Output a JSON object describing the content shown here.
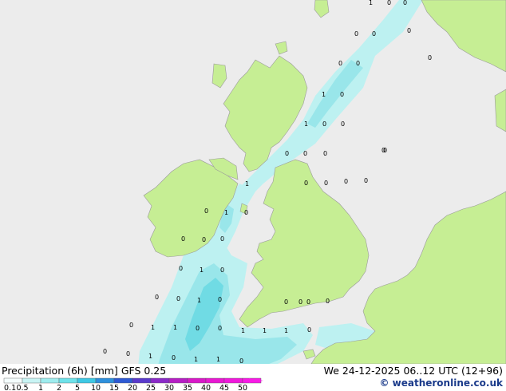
{
  "title": "Precipitation (6h) [mm]",
  "model": "GFS 0.25",
  "datetime": "We 24-12-2025 06..12 UTC (12+96)",
  "credit": "© weatheronline.co.uk",
  "legend": {
    "ticks": [
      "0.1",
      "0.5",
      "1",
      "2",
      "5",
      "10",
      "15",
      "20",
      "25",
      "30",
      "35",
      "40",
      "45",
      "50"
    ],
    "colors": [
      "#f5fdfd",
      "#c8f4f4",
      "#9eecee",
      "#6ee2ea",
      "#3ec8e4",
      "#2f90dc",
      "#2e5ad4",
      "#5a3acc",
      "#8a2ac8",
      "#b61ec4",
      "#d818c8",
      "#e818d2",
      "#f018dc",
      "#f81ae6"
    ]
  },
  "colors": {
    "sea": "#ececec",
    "land": "#c6ee94",
    "border": "#9a9a9a",
    "precip_light": "#bdf1f1",
    "precip_medium": "#99e6ea",
    "precip_strong": "#70dbe4"
  },
  "map_labels": [
    {
      "name": "label-north-1",
      "text": "1"
    },
    {
      "name": "label-north-2",
      "text": "0"
    },
    {
      "name": "label-north-3",
      "text": "0"
    },
    {
      "name": "label-north-4",
      "text": "0"
    },
    {
      "name": "label-north-5",
      "text": "0"
    },
    {
      "name": "label-north-6",
      "text": "0"
    },
    {
      "name": "label-north-7",
      "text": "0"
    },
    {
      "name": "label-north-8",
      "text": "0"
    },
    {
      "name": "label-north-9",
      "text": "0"
    },
    {
      "name": "label-scot-1",
      "text": "1"
    },
    {
      "name": "label-scot-2",
      "text": "0"
    },
    {
      "name": "label-scot-3",
      "text": "1"
    },
    {
      "name": "label-scot-4",
      "text": "0"
    },
    {
      "name": "label-scot-5",
      "text": "0"
    },
    {
      "name": "label-ns-1",
      "text": "0"
    },
    {
      "name": "label-ns-2",
      "text": "0"
    },
    {
      "name": "label-ns-3",
      "text": "0"
    },
    {
      "name": "label-ns-4",
      "text": "0"
    },
    {
      "name": "label-ns-5",
      "text": "0"
    },
    {
      "name": "label-ns-6",
      "text": "0"
    },
    {
      "name": "label-ns-7",
      "text": "0"
    },
    {
      "name": "label-ns-8",
      "text": "0"
    },
    {
      "name": "label-ns-9",
      "text": "0"
    },
    {
      "name": "label-irish-1",
      "text": "1"
    },
    {
      "name": "label-irish-2",
      "text": "0"
    },
    {
      "name": "label-irish-3",
      "text": "1"
    },
    {
      "name": "label-irish-4",
      "text": "0"
    },
    {
      "name": "label-irish-5",
      "text": "0"
    },
    {
      "name": "label-irish-6",
      "text": "0"
    },
    {
      "name": "label-irish-7",
      "text": "0"
    },
    {
      "name": "label-celtic-1",
      "text": "1"
    },
    {
      "name": "label-celtic-2",
      "text": "0"
    },
    {
      "name": "label-celtic-3",
      "text": "0"
    },
    {
      "name": "label-celtic-4",
      "text": "0"
    },
    {
      "name": "label-celtic-5",
      "text": "1"
    },
    {
      "name": "label-celtic-6",
      "text": "0"
    },
    {
      "name": "label-celtic-7",
      "text": "0"
    },
    {
      "name": "label-chan-1",
      "text": "0"
    },
    {
      "name": "label-chan-2",
      "text": "0"
    },
    {
      "name": "label-chan-3",
      "text": "0"
    },
    {
      "name": "label-chan-4",
      "text": "0"
    },
    {
      "name": "label-sw-1",
      "text": "0"
    },
    {
      "name": "label-sw-2",
      "text": "1"
    },
    {
      "name": "label-sw-3",
      "text": "1"
    },
    {
      "name": "label-sw-4",
      "text": "0"
    },
    {
      "name": "label-sw-5",
      "text": "0"
    },
    {
      "name": "label-sw-6",
      "text": "1"
    },
    {
      "name": "label-sw-7",
      "text": "1"
    },
    {
      "name": "label-sw-8",
      "text": "1"
    },
    {
      "name": "label-sw-9",
      "text": "0"
    },
    {
      "name": "label-sw-10",
      "text": "0"
    },
    {
      "name": "label-sw-11",
      "text": "0"
    },
    {
      "name": "label-sw-12",
      "text": "1"
    },
    {
      "name": "label-sw-13",
      "text": "0"
    },
    {
      "name": "label-sw-14",
      "text": "1"
    },
    {
      "name": "label-sw-15",
      "text": "1"
    },
    {
      "name": "label-sw-16",
      "text": "0"
    }
  ]
}
